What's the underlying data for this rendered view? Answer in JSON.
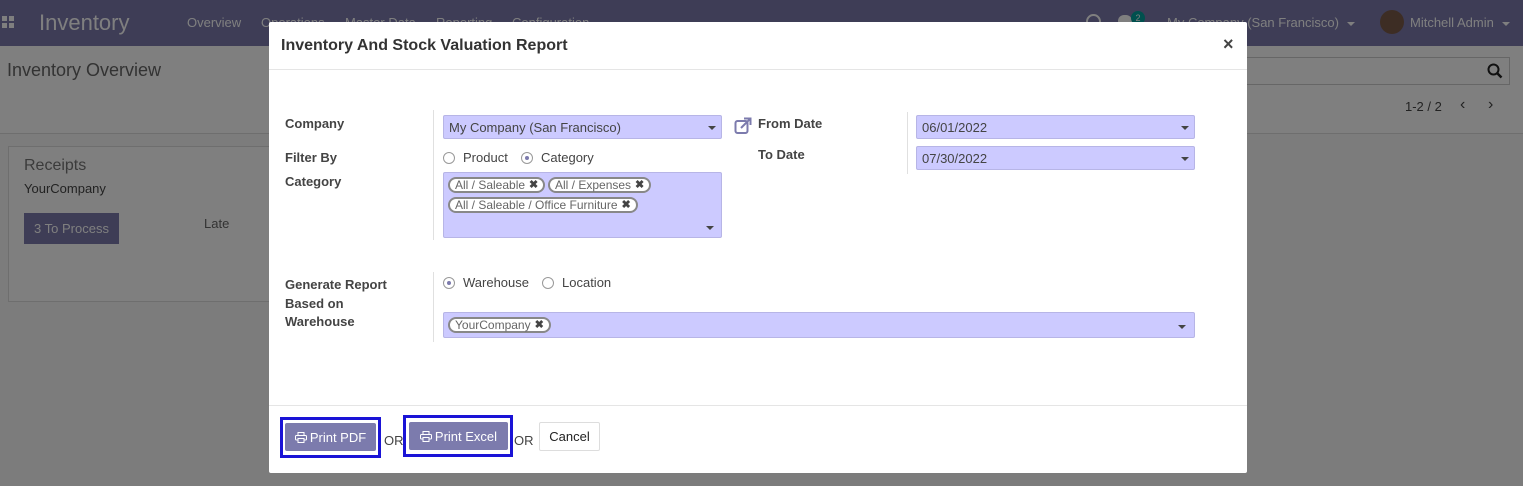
{
  "app": {
    "name": "Inventory",
    "menu": [
      "Overview",
      "Operations",
      "Master Data",
      "Reporting",
      "Configuration"
    ],
    "chat_badge": "2",
    "company_switcher": "My Company (San Francisco)",
    "user": "Mitchell Admin"
  },
  "control_panel": {
    "title": "Inventory Overview",
    "pager": "1-2 / 2"
  },
  "card": {
    "title": "Receipts",
    "company": "YourCompany",
    "process_label": "3 To Process",
    "late_label": "Late"
  },
  "modal": {
    "title": "Inventory And Stock Valuation Report",
    "close": "×",
    "company_label": "Company",
    "company_value": "My Company (San Francisco)",
    "filter_by_label": "Filter By",
    "filter_options": [
      "Product",
      "Category"
    ],
    "filter_selected": "Category",
    "category_label": "Category",
    "categories": [
      "All / Saleable",
      "All / Expenses",
      "All / Saleable / Office Furniture"
    ],
    "from_date_label": "From Date",
    "from_date": "06/01/2022",
    "to_date_label": "To Date",
    "to_date": "07/30/2022",
    "based_on_label": "Generate Report Based on",
    "based_on_options": [
      "Warehouse",
      "Location"
    ],
    "based_on_selected": "Warehouse",
    "warehouse_label": "Warehouse",
    "warehouses": [
      "YourCompany"
    ],
    "footer": {
      "print_pdf": "Print PDF",
      "or": "OR",
      "print_excel": "Print Excel",
      "cancel": "Cancel"
    }
  },
  "colors": {
    "brand": "#7c7bad",
    "field_bg": "#cccaff",
    "highlight": "#1a13d6"
  }
}
